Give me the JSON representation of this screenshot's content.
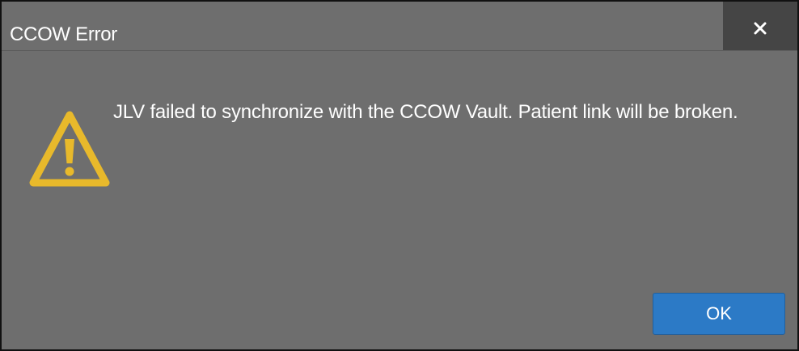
{
  "dialog": {
    "title": "CCOW Error",
    "message": "JLV failed to synchronize with the CCOW Vault. Patient link will be broken.",
    "icon": "warning-icon",
    "ok_label": "OK",
    "close_icon": "close-icon"
  },
  "colors": {
    "dialog_background": "#6e6e6e",
    "close_background": "#454545",
    "warning_accent": "#e8b92b",
    "ok_button": "#2c7ac6"
  }
}
